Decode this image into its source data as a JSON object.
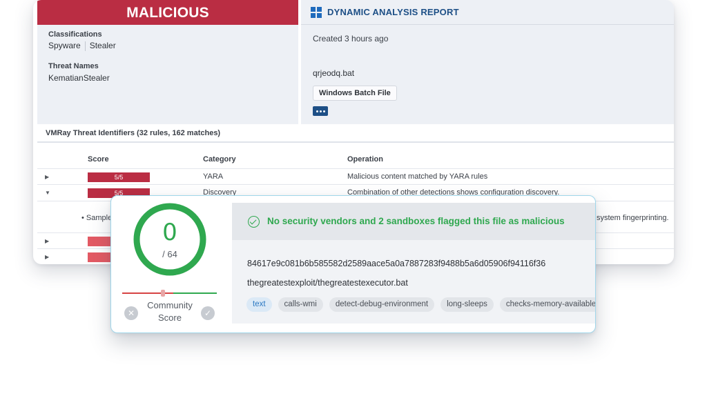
{
  "report": {
    "verdict": "MALICIOUS",
    "classifications_label": "Classifications",
    "classifications": [
      "Spyware",
      "Stealer"
    ],
    "threat_names_label": "Threat Names",
    "threat_name": "KematianStealer",
    "dynamic_title": "DYNAMIC ANALYSIS REPORT",
    "created": "Created 3 hours ago",
    "filename": "qrjeodq.bat",
    "file_type": "Windows Batch File",
    "vti_title": "VMRay Threat Identifiers (32 rules, 162 matches)",
    "columns": {
      "score": "Score",
      "category": "Category",
      "operation": "Operation"
    },
    "rows": [
      {
        "score": "5/5",
        "category": "YARA",
        "operation": "Malicious content matched by YARA rules",
        "expanded": false
      },
      {
        "score": "5/5",
        "category": "Discovery",
        "operation": "Combination of other detections shows configuration discovery.",
        "expanded": true
      }
    ],
    "detail_left": "• Sample",
    "detail_right": "system fingerprinting."
  },
  "vt": {
    "detections": "0",
    "total": "/ 64",
    "community_score_label_1": "Community",
    "community_score_label_2": "Score",
    "alert": "No security vendors and 2 sandboxes flagged this file as malicious",
    "hash": "84617e9c081b6b585582d2589aace5a0a7887283f9488b5a6d05906f94116f36",
    "file_path": "thegreatestexploit/thegreatestexecutor.bat",
    "tags": [
      "text",
      "calls-wmi",
      "detect-debug-environment",
      "long-sleeps",
      "checks-memory-available"
    ]
  },
  "colors": {
    "malicious_red": "#ba2d43",
    "clean_green": "#2fa84f",
    "vmray_blue": "#1d4f86",
    "tag_blue": "#2b78c2"
  },
  "icons": [
    "windows-icon",
    "more-dots-icon",
    "caret-right-icon",
    "caret-down-icon",
    "check-circle-icon",
    "close-circle-icon",
    "check-filled-icon"
  ]
}
